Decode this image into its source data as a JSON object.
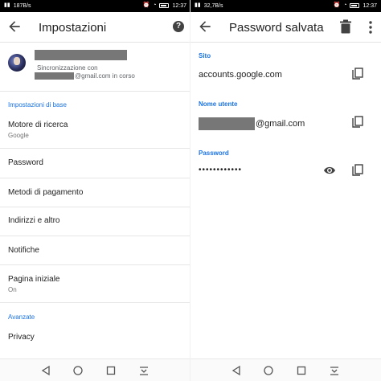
{
  "left": {
    "status": {
      "speed": "187B/s",
      "time": "12:37"
    },
    "title": "Impostazioni",
    "account": {
      "sync_text": "Sincronizzazione con",
      "email_suffix": "@gmail.com in corso"
    },
    "sections": {
      "basic": "Impostazioni di base",
      "advanced": "Avanzate"
    },
    "items": {
      "search_engine": {
        "label": "Motore di ricerca",
        "sub": "Google"
      },
      "password": {
        "label": "Password"
      },
      "payments": {
        "label": "Metodi di pagamento"
      },
      "addresses": {
        "label": "Indirizzi e altro"
      },
      "notifications": {
        "label": "Notifiche"
      },
      "homepage": {
        "label": "Pagina iniziale",
        "sub": "On"
      },
      "privacy": {
        "label": "Privacy"
      }
    }
  },
  "right": {
    "status": {
      "speed": "32,7B/s",
      "time": "12:37"
    },
    "title": "Password salvata",
    "site": {
      "label": "Sito",
      "value": "accounts.google.com"
    },
    "username": {
      "label": "Nome utente",
      "suffix": "@gmail.com"
    },
    "password": {
      "label": "Password",
      "masked": "••••••••••••"
    }
  },
  "icons": {
    "back": "arrow-left-icon",
    "help": "help-icon",
    "delete": "trash-icon",
    "more": "more-vert-icon",
    "copy": "copy-icon",
    "show": "eye-icon",
    "nav_back": "triangle-back-icon",
    "nav_home": "circle-home-icon",
    "nav_recent": "square-recent-icon",
    "nav_notif": "notification-pull-icon"
  },
  "colors": {
    "accent": "#1a73e8",
    "text": "#212121",
    "secondary": "#757575"
  }
}
